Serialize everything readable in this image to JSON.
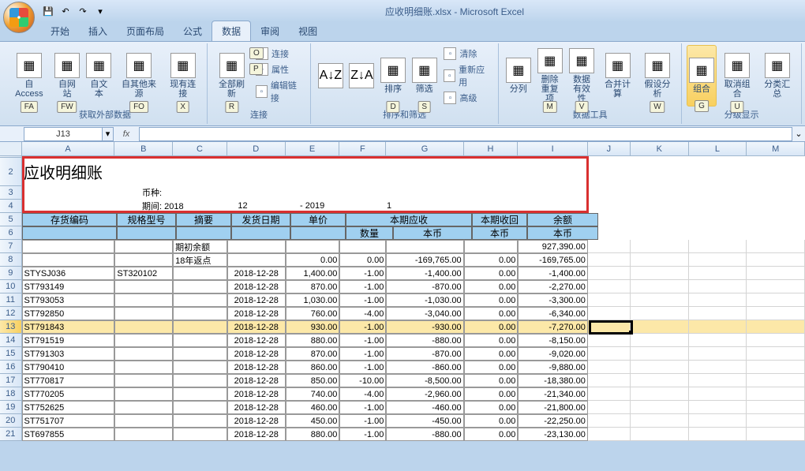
{
  "app": {
    "title": "应收明细账.xlsx - Microsoft Excel"
  },
  "tabs": [
    "开始",
    "插入",
    "页面布局",
    "公式",
    "数据",
    "审阅",
    "视图"
  ],
  "active_tab_index": 4,
  "ribbon": {
    "groups": [
      {
        "label": "获取外部数据",
        "key": "",
        "buttons": [
          {
            "label": "自 Access",
            "key": "FA"
          },
          {
            "label": "自网站",
            "key": "FW"
          },
          {
            "label": "自文本",
            "key": ""
          },
          {
            "label": "自其他来源",
            "key": "FO"
          },
          {
            "label": "现有连接",
            "key": "X"
          }
        ]
      },
      {
        "label": "连接",
        "buttons": [
          {
            "label": "全部刷新",
            "key": "R"
          }
        ],
        "small": [
          "连接",
          "属性",
          "编辑链接"
        ],
        "small_keys": [
          "O",
          "P",
          ""
        ]
      },
      {
        "label": "排序和筛选",
        "buttons": [
          {
            "label": "",
            "icon": "A↓Z",
            "key": ""
          },
          {
            "label": "",
            "icon": "Z↓A",
            "key": ""
          },
          {
            "label": "排序",
            "key": "D"
          },
          {
            "label": "筛选",
            "key": "S"
          }
        ],
        "small": [
          "清除",
          "重新应用",
          "高级"
        ]
      },
      {
        "label": "数据工具",
        "buttons": [
          {
            "label": "分列",
            "key": ""
          },
          {
            "label": "删除\n重复项",
            "key": "M"
          },
          {
            "label": "数据\n有效性",
            "key": "V"
          },
          {
            "label": "合并计算",
            "key": ""
          },
          {
            "label": "假设分析",
            "key": "W"
          }
        ]
      },
      {
        "label": "分级显示",
        "buttons": [
          {
            "label": "组合",
            "key": "G",
            "highlighted": true
          },
          {
            "label": "取消组合",
            "key": "U"
          },
          {
            "label": "分类汇总",
            "key": ""
          }
        ]
      }
    ]
  },
  "name_box": "J13",
  "columns": [
    "A",
    "B",
    "C",
    "D",
    "E",
    "F",
    "G",
    "H",
    "I",
    "J",
    "K",
    "L",
    "M"
  ],
  "sheet": {
    "title": "应收明细账",
    "meta": {
      "currency_label": "币种:",
      "period_label": "期间:",
      "period_y1": "2018",
      "period_m1": "12",
      "dash": "-",
      "period_y2": "2019",
      "period_m2": "1"
    },
    "headers": {
      "inv_code": "存货编码",
      "spec": "规格型号",
      "summary": "摘要",
      "ship_date": "发货日期",
      "price": "单价",
      "ar_group": "本期应收",
      "qty": "数量",
      "local": "本币",
      "recv_group": "本期收回",
      "balance": "余额"
    },
    "rows": [
      {
        "r": 7,
        "code": "",
        "spec": "",
        "summary": "期初余额",
        "date": "",
        "price": "",
        "qty": "",
        "ar": "",
        "recv": "",
        "bal": "927,390.00"
      },
      {
        "r": 8,
        "code": "",
        "spec": "",
        "summary": "18年返点",
        "date": "",
        "price": "0.00",
        "qty": "0.00",
        "ar": "-169,765.00",
        "recv": "0.00",
        "bal": "-169,765.00"
      },
      {
        "r": 9,
        "code": "STYSJ036",
        "spec": "ST320102",
        "summary": "",
        "date": "2018-12-28",
        "price": "1,400.00",
        "qty": "-1.00",
        "ar": "-1,400.00",
        "recv": "0.00",
        "bal": "-1,400.00"
      },
      {
        "r": 10,
        "code": "ST793149",
        "spec": "",
        "summary": "",
        "date": "2018-12-28",
        "price": "870.00",
        "qty": "-1.00",
        "ar": "-870.00",
        "recv": "0.00",
        "bal": "-2,270.00"
      },
      {
        "r": 11,
        "code": "ST793053",
        "spec": "",
        "summary": "",
        "date": "2018-12-28",
        "price": "1,030.00",
        "qty": "-1.00",
        "ar": "-1,030.00",
        "recv": "0.00",
        "bal": "-3,300.00"
      },
      {
        "r": 12,
        "code": "ST792850",
        "spec": "",
        "summary": "",
        "date": "2018-12-28",
        "price": "760.00",
        "qty": "-4.00",
        "ar": "-3,040.00",
        "recv": "0.00",
        "bal": "-6,340.00"
      },
      {
        "r": 13,
        "code": "ST791843",
        "spec": "",
        "summary": "",
        "date": "2018-12-28",
        "price": "930.00",
        "qty": "-1.00",
        "ar": "-930.00",
        "recv": "0.00",
        "bal": "-7,270.00",
        "selected": true
      },
      {
        "r": 14,
        "code": "ST791519",
        "spec": "",
        "summary": "",
        "date": "2018-12-28",
        "price": "880.00",
        "qty": "-1.00",
        "ar": "-880.00",
        "recv": "0.00",
        "bal": "-8,150.00"
      },
      {
        "r": 15,
        "code": "ST791303",
        "spec": "",
        "summary": "",
        "date": "2018-12-28",
        "price": "870.00",
        "qty": "-1.00",
        "ar": "-870.00",
        "recv": "0.00",
        "bal": "-9,020.00"
      },
      {
        "r": 16,
        "code": "ST790410",
        "spec": "",
        "summary": "",
        "date": "2018-12-28",
        "price": "860.00",
        "qty": "-1.00",
        "ar": "-860.00",
        "recv": "0.00",
        "bal": "-9,880.00"
      },
      {
        "r": 17,
        "code": "ST770817",
        "spec": "",
        "summary": "",
        "date": "2018-12-28",
        "price": "850.00",
        "qty": "-10.00",
        "ar": "-8,500.00",
        "recv": "0.00",
        "bal": "-18,380.00"
      },
      {
        "r": 18,
        "code": "ST770205",
        "spec": "",
        "summary": "",
        "date": "2018-12-28",
        "price": "740.00",
        "qty": "-4.00",
        "ar": "-2,960.00",
        "recv": "0.00",
        "bal": "-21,340.00"
      },
      {
        "r": 19,
        "code": "ST752625",
        "spec": "",
        "summary": "",
        "date": "2018-12-28",
        "price": "460.00",
        "qty": "-1.00",
        "ar": "-460.00",
        "recv": "0.00",
        "bal": "-21,800.00"
      },
      {
        "r": 20,
        "code": "ST751707",
        "spec": "",
        "summary": "",
        "date": "2018-12-28",
        "price": "450.00",
        "qty": "-1.00",
        "ar": "-450.00",
        "recv": "0.00",
        "bal": "-22,250.00"
      },
      {
        "r": 21,
        "code": "ST697855",
        "spec": "",
        "summary": "",
        "date": "2018-12-28",
        "price": "880.00",
        "qty": "-1.00",
        "ar": "-880.00",
        "recv": "0.00",
        "bal": "-23,130.00"
      }
    ]
  }
}
